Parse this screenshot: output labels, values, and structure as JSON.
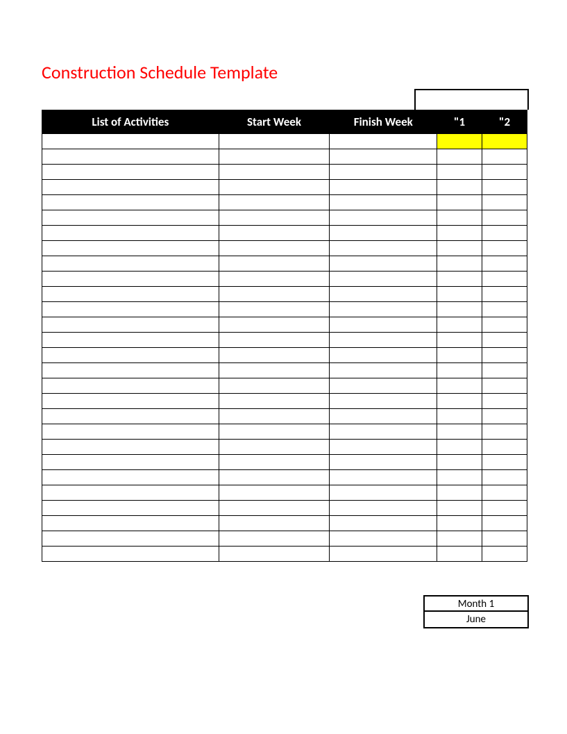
{
  "title": "Construction Schedule Template",
  "headers": {
    "activities": "List of Activities",
    "start": "Start Week",
    "finish": "Finish Week",
    "week1": "\"1",
    "week2": "\"2"
  },
  "rowCount": 28,
  "highlightedRow": 0,
  "monthBox": {
    "label": "Month 1",
    "value": "June"
  }
}
